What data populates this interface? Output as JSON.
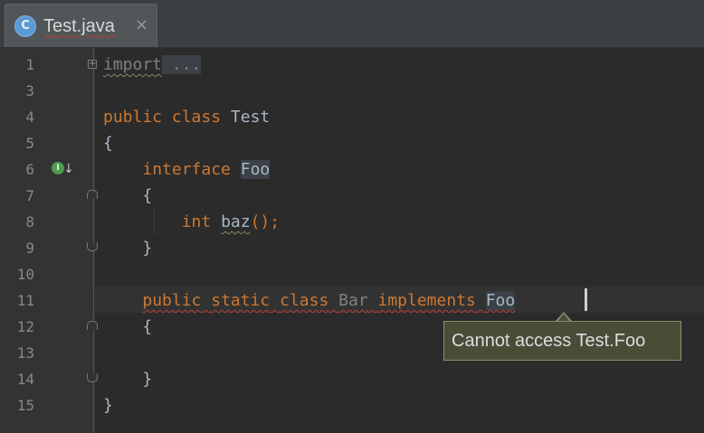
{
  "tab": {
    "icon_letter": "C",
    "label": "Test.java",
    "close": "×"
  },
  "line_numbers": [
    "1",
    "3",
    "4",
    "5",
    "6",
    "7",
    "8",
    "9",
    "10",
    "11",
    "12",
    "13",
    "14",
    "15"
  ],
  "code": {
    "l1_kw": "import",
    "l1_rest": " ...",
    "l4_kw1": "public",
    "l4_kw2": "class",
    "l4_name": "Test",
    "l5": "{",
    "l6_kw": "interface",
    "l6_name": "Foo",
    "l7": "{",
    "l8_kw": "int",
    "l8_method": "baz",
    "l8_rest": "();",
    "l9": "}",
    "l11_kw1": "public",
    "l11_kw2": "static",
    "l11_kw3": "class",
    "l11_name": "Bar",
    "l11_kw4": "implements",
    "l11_ref": "Foo",
    "l12": "{",
    "l14": "}",
    "l15": "}"
  },
  "gutter": {
    "implemented_icon_letter": "I",
    "implemented_arrow": "↓"
  },
  "tooltip": {
    "text": "Cannot access Test.Foo"
  },
  "colors": {
    "keyword": "#cc7832",
    "text": "#a9b7c6",
    "error_underline": "#bc3f3c",
    "tooltip_bg": "#4b4c38"
  }
}
